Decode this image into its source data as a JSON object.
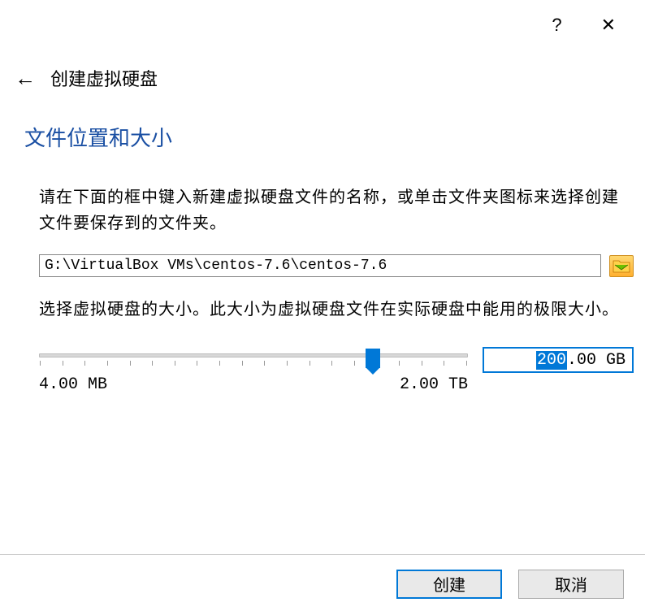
{
  "window": {
    "title": "创建虚拟硬盘"
  },
  "section": {
    "heading": "文件位置和大小",
    "path_description": "请在下面的框中键入新建虚拟硬盘文件的名称，或单击文件夹图标来选择创建文件要保存到的文件夹。",
    "size_description": "选择虚拟硬盘的大小。此大小为虚拟硬盘文件在实际硬盘中能用的极限大小。"
  },
  "inputs": {
    "file_path": "G:\\VirtualBox VMs\\centos-7.6\\centos-7.6",
    "size_selected": "200",
    "size_suffix": ".00 GB"
  },
  "slider": {
    "min_label": "4.00 MB",
    "max_label": "2.00 TB",
    "position_percent": 78
  },
  "buttons": {
    "create": "创建",
    "cancel": "取消"
  }
}
